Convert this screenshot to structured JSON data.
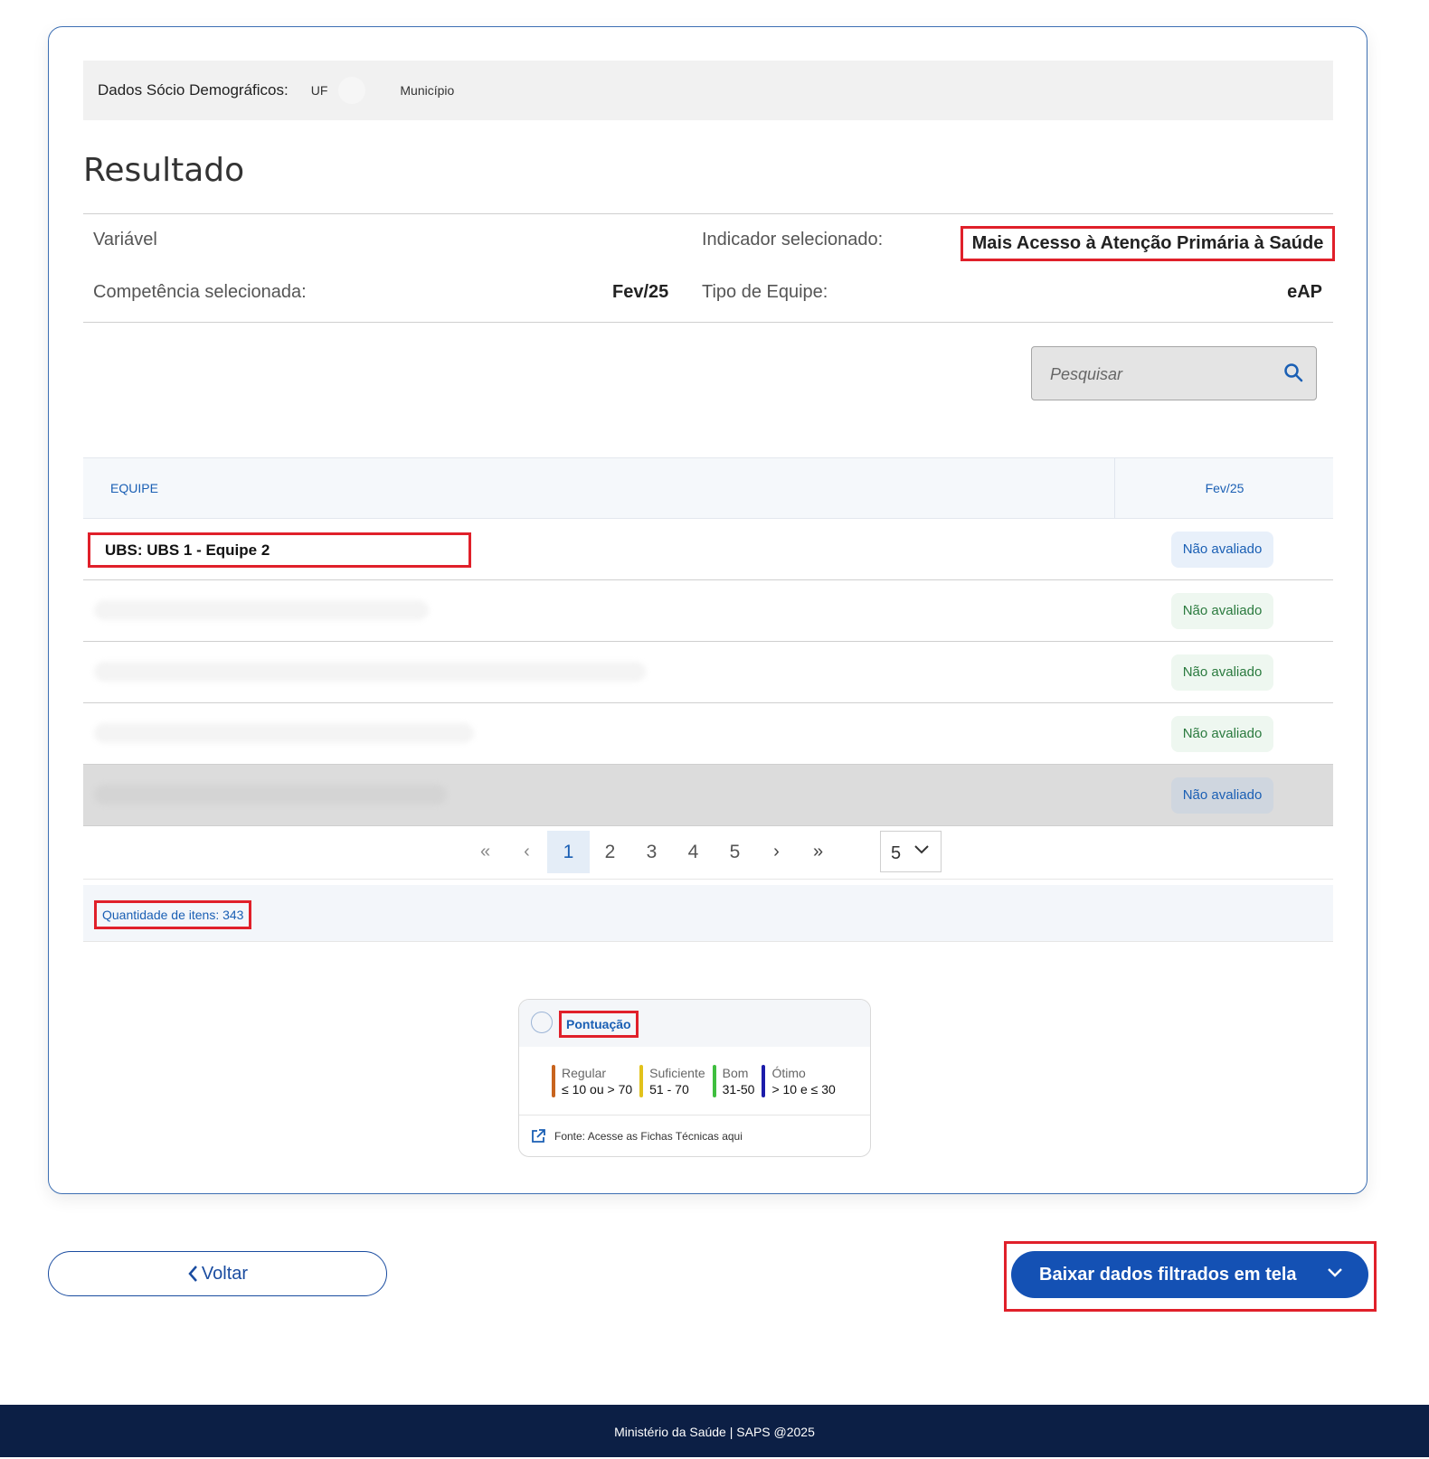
{
  "filters": {
    "label": "Dados Sócio Demográficos:",
    "uf": "UF",
    "municipio": "Município"
  },
  "result": {
    "title": "Resultado",
    "variable_label": "Variável",
    "indicator_label": "Indicador selecionado:",
    "indicator_value": "Mais Acesso à Atenção Primária à Saúde",
    "competence_label": "Competência selecionada:",
    "competence_value": "Fev/25",
    "team_type_label": "Tipo de Equipe:",
    "team_type_value": "eAP"
  },
  "search": {
    "placeholder": "Pesquisar",
    "icon": "search-icon"
  },
  "table": {
    "columns": [
      "EQUIPE",
      "Fev/25"
    ],
    "rows": [
      {
        "team": "UBS: UBS 1 - Equipe 2",
        "status": "Não avaliado",
        "status_color": "blue"
      },
      {
        "team": "",
        "status": "Não avaliado",
        "status_color": "green"
      },
      {
        "team": "",
        "status": "Não avaliado",
        "status_color": "green"
      },
      {
        "team": "",
        "status": "Não avaliado",
        "status_color": "green"
      },
      {
        "team": "",
        "status": "Não avaliado",
        "status_color": "blue",
        "selected": true
      }
    ]
  },
  "pagination": {
    "first": "«",
    "prev": "‹",
    "pages": [
      "1",
      "2",
      "3",
      "4",
      "5"
    ],
    "current": "1",
    "next": "›",
    "last": "»",
    "page_size": "5"
  },
  "quantity": {
    "label": "Quantidade de itens: 343"
  },
  "legend": {
    "title": "Pontuação",
    "items": [
      {
        "name": "Regular",
        "range": "≤ 10 ou > 70",
        "color": "#c8641e"
      },
      {
        "name": "Suficiente",
        "range": "51 - 70",
        "color": "#e2c21b"
      },
      {
        "name": "Bom",
        "range": "31-50",
        "color": "#3fbe3f"
      },
      {
        "name": "Ótimo",
        "range": "> 10 e ≤ 30",
        "color": "#1c1caa"
      }
    ],
    "source": "Fonte: Acesse as Fichas Técnicas aqui"
  },
  "actions": {
    "back": "Voltar",
    "download": "Baixar dados filtrados em tela"
  },
  "footer": {
    "text": "Ministério da Saúde | SAPS @2025"
  },
  "colors": {
    "primary": "#1451b4",
    "highlight": "#e0202a",
    "footer_bg": "#0c1f45"
  }
}
